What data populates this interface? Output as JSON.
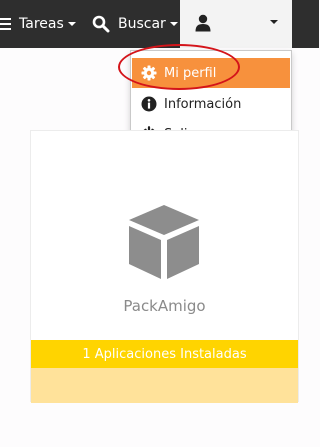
{
  "navbar": {
    "tareas_label": "Tareas",
    "buscar_label": "Buscar"
  },
  "dropdown": {
    "items": [
      {
        "label": "Mi perfil",
        "icon": "gear-icon"
      },
      {
        "label": "Información",
        "icon": "info-icon"
      },
      {
        "label": "Salir",
        "icon": "power-icon"
      }
    ]
  },
  "card": {
    "app_name": "PackAmigo",
    "status": "1 Aplicaciones Instaladas"
  },
  "colors": {
    "navbar_bg": "#2e2e2e",
    "active_item": "#f7913d",
    "status_bar": "#ffd400",
    "footer_bar": "#ffe29a",
    "annotation": "#d4141a"
  }
}
